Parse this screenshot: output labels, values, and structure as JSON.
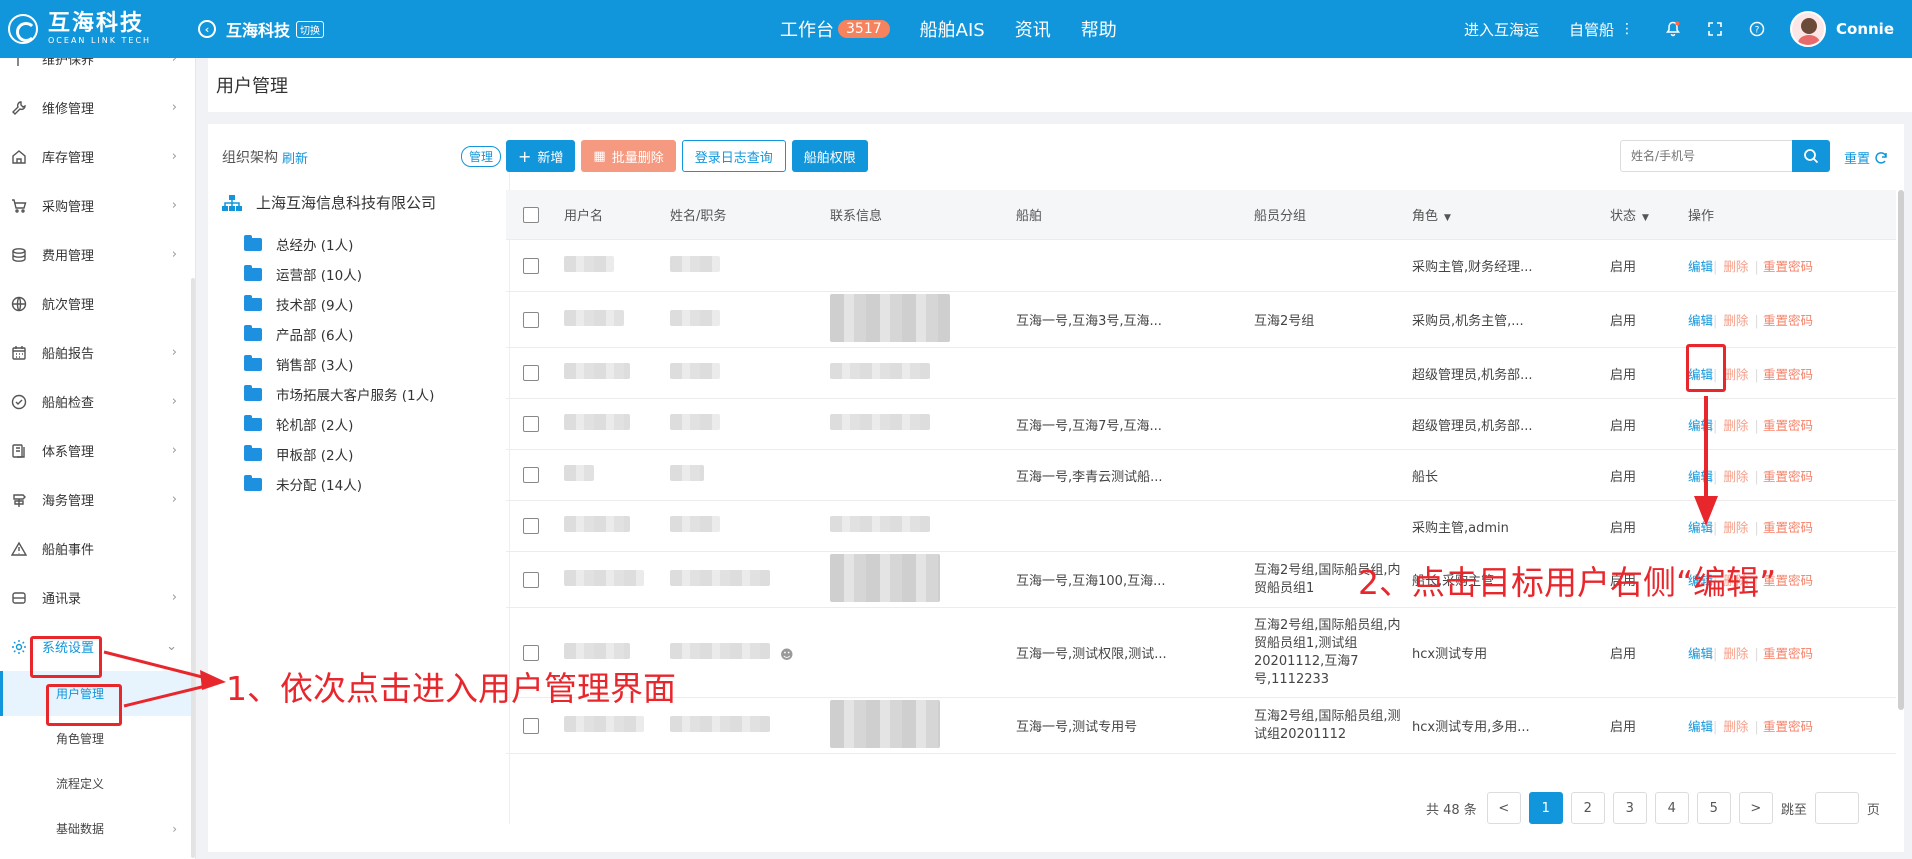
{
  "topbar": {
    "brand_cn": "互海科技",
    "brand_en": "OCEAN LINK TECH",
    "company": "互海科技",
    "switch_label": "切换",
    "nav": [
      {
        "label": "工作台",
        "badge": "3517"
      },
      {
        "label": "船舶AIS"
      },
      {
        "label": "资讯"
      },
      {
        "label": "帮助"
      }
    ],
    "right_links": [
      "进入互海运",
      "自管船"
    ],
    "username": "Connie"
  },
  "sidebar": {
    "items": [
      {
        "label": "维护保养"
      },
      {
        "label": "维修管理"
      },
      {
        "label": "库存管理"
      },
      {
        "label": "采购管理"
      },
      {
        "label": "费用管理"
      },
      {
        "label": "航次管理"
      },
      {
        "label": "船舶报告"
      },
      {
        "label": "船舶检查"
      },
      {
        "label": "体系管理"
      },
      {
        "label": "海务管理"
      },
      {
        "label": "船舶事件"
      },
      {
        "label": "通讯录"
      },
      {
        "label": "系统设置"
      }
    ],
    "sub_items": [
      {
        "label": "用户管理"
      },
      {
        "label": "角色管理"
      },
      {
        "label": "流程定义"
      },
      {
        "label": "基础数据"
      }
    ]
  },
  "page": {
    "title": "用户管理"
  },
  "org": {
    "title": "组织架构",
    "refresh": "刷新",
    "manage": "管理",
    "root": "上海互海信息科技有限公司",
    "nodes": [
      "总经办 (1人)",
      "运营部 (10人)",
      "技术部 (9人)",
      "产品部 (6人)",
      "销售部 (3人)",
      "市场拓展大客户服务 (1人)",
      "轮机部 (2人)",
      "甲板部 (2人)",
      "未分配 (14人)"
    ]
  },
  "toolbar": {
    "add": "新增",
    "batch_delete": "批量删除",
    "login_log": "登录日志查询",
    "ship_perm": "船舶权限",
    "search_placeholder": "姓名/手机号",
    "reset": "重置"
  },
  "table": {
    "headers": {
      "user": "用户名",
      "name": "姓名/职务",
      "contact": "联系信息",
      "ship": "船舶",
      "group": "船员分组",
      "role": "角色",
      "status": "状态",
      "ops": "操作"
    },
    "rows": [
      {
        "ship": "",
        "group": "",
        "role": "采购主管,财务经理...",
        "status": "启用"
      },
      {
        "ship": "互海一号,互海3号,互海...",
        "group": "互海2号组",
        "role": "采购员,机务主管,...",
        "status": "启用"
      },
      {
        "ship": "",
        "group": "",
        "role": "超级管理员,机务部...",
        "status": "启用"
      },
      {
        "ship": "互海一号,互海7号,互海...",
        "group": "",
        "role": "超级管理员,机务部...",
        "status": "启用"
      },
      {
        "ship": "互海一号,李青云测试船...",
        "group": "",
        "role": "船长",
        "status": "启用"
      },
      {
        "ship": "",
        "group": "",
        "role": "采购主管,admin",
        "status": "启用"
      },
      {
        "ship": "互海一号,互海100,互海...",
        "group": "互海2号组,国际船员组,内贸船员组1",
        "role": "船长,采购主管",
        "status": "启用"
      },
      {
        "ship": "互海一号,测试权限,测试...",
        "group": "互海2号组,国际船员组,内贸船员组1,测试组20201112,互海7号,1112233",
        "role": "hcx测试专用",
        "status": "启用"
      },
      {
        "ship": "互海一号,测试专用号",
        "group": "互海2号组,国际船员组,测试组20201112",
        "role": "hcx测试专用,多用...",
        "status": "启用"
      }
    ],
    "ops": {
      "edit": "编辑",
      "delete": "删除",
      "reset_pwd": "重置密码"
    }
  },
  "pager": {
    "total": "共 48 条",
    "prev": "<",
    "pages": [
      "1",
      "2",
      "3",
      "4",
      "5"
    ],
    "current": "1",
    "next": ">",
    "jump_label": "跳至",
    "page_unit": "页"
  },
  "annotations": {
    "step1": "1、依次点击进入用户管理界面",
    "step2": "2、点击目标用户右侧“编辑”"
  },
  "colors": {
    "primary": "#1296db",
    "annotation": "#e8272d",
    "badge": "#f5835e"
  }
}
